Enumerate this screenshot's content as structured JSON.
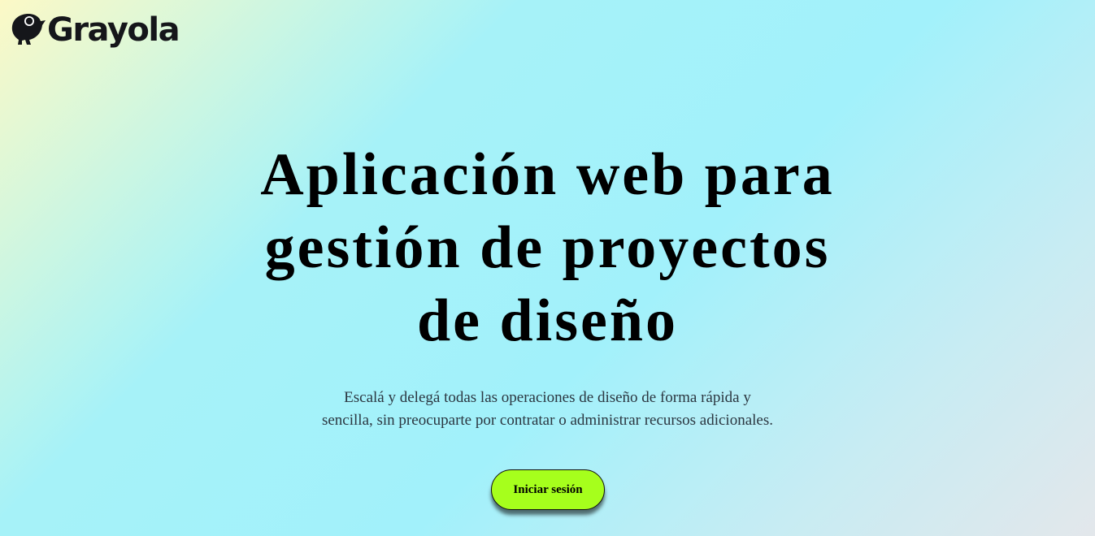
{
  "brand": {
    "name": "Grayola",
    "logo_icon": "bird-icon"
  },
  "hero": {
    "title_line1": "Aplicación web para",
    "title_line2": "gestión de proyectos",
    "title_line3": "de diseño",
    "subtitle": "Escalá y delegá todas las operaciones de diseño de forma rápida y sencilla, sin preocuparte por contratar o administrar recursos adicionales."
  },
  "cta": {
    "label": "Iniciar sesión",
    "color": "#a6ff1c"
  }
}
